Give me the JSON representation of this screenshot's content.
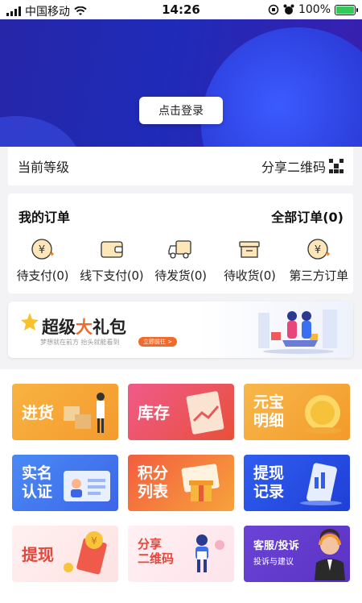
{
  "status_bar": {
    "carrier": "中国移动",
    "time": "14:26",
    "battery": "100%"
  },
  "hero": {
    "login_label": "点击登录"
  },
  "level": {
    "label": "当前等级",
    "share_label": "分享二维码"
  },
  "orders": {
    "title": "我的订单",
    "all_label": "全部订单(0)",
    "items": [
      {
        "label": "待支付(0)",
        "icon": "yen-coin-icon"
      },
      {
        "label": "线下支付(0)",
        "icon": "wallet-icon"
      },
      {
        "label": "待发货(0)",
        "icon": "truck-icon"
      },
      {
        "label": "待收货(0)",
        "icon": "box-icon"
      },
      {
        "label": "第三方订单",
        "icon": "yen-coin-icon"
      }
    ]
  },
  "banner": {
    "title_a": "超级",
    "title_b": "大",
    "title_c": "礼包",
    "subtitle": "梦想就在前方  抬头就能看到",
    "button": "立即前往 >"
  },
  "tiles": [
    {
      "label": "进货",
      "color": "#f6a23a"
    },
    {
      "label": "库存",
      "color": "#e84e7e"
    },
    {
      "label": "元宝\n明细",
      "color": "#f7b02c"
    },
    {
      "label": "实名\n认证",
      "color": "#3f78f0"
    },
    {
      "label": "积分\n列表",
      "color": "#f15a3a"
    },
    {
      "label": "提现\n记录",
      "color": "#2c57e6"
    },
    {
      "label": "提现",
      "color": "#fde8e8"
    },
    {
      "label": "分享\n二维码",
      "color": "#fde6ec"
    },
    {
      "label": "客服/投诉",
      "sub": "投诉与建议",
      "color": "#6a3fd1"
    }
  ]
}
